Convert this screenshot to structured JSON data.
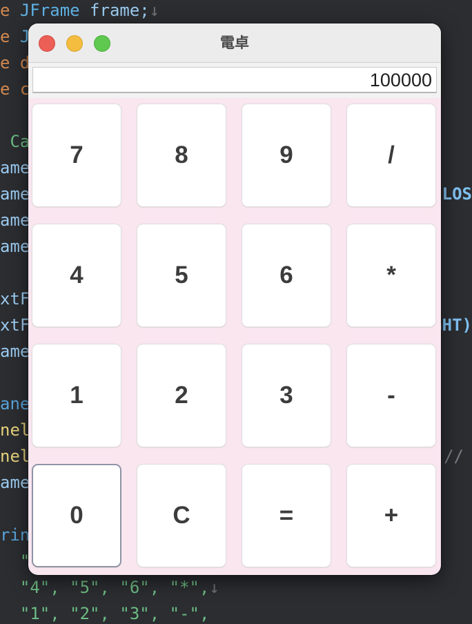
{
  "editor": {
    "lines": [
      {
        "a": "e ",
        "b": "JFrame",
        "c": " frame;",
        "d": "↓"
      },
      {
        "a": "e ",
        "b": "JT"
      },
      {
        "a": "e ",
        "b": "de"
      },
      {
        "a": "e ",
        "b": "ch"
      },
      {
        "a": " Ca"
      },
      {
        "a": "ame"
      },
      {
        "a": "ame"
      },
      {
        "a": "ame"
      },
      {
        "a": "ame"
      },
      {
        "a": "xtF:"
      },
      {
        "a": "xtF:"
      },
      {
        "a": "ame"
      },
      {
        "a": "ane"
      },
      {
        "a": "nel"
      },
      {
        "a": "nel"
      },
      {
        "a": "ame"
      },
      {
        "a": "ring"
      },
      {
        "a": "  \"",
        "b": "\""
      },
      {
        "a": "  \"4\", \"5\", \"6\", \"*\",",
        "b": "↓"
      },
      {
        "a": "  \"1\", \"2\", \"3\", \"-\","
      }
    ],
    "right_fragments": {
      "close": "CLOS",
      "right": "GHT)",
      "comment": "//"
    }
  },
  "window": {
    "title": "電卓",
    "display_value": "100000",
    "keys": [
      {
        "label": "7"
      },
      {
        "label": "8"
      },
      {
        "label": "9"
      },
      {
        "label": "/"
      },
      {
        "label": "4"
      },
      {
        "label": "5"
      },
      {
        "label": "6"
      },
      {
        "label": "*"
      },
      {
        "label": "1"
      },
      {
        "label": "2"
      },
      {
        "label": "3"
      },
      {
        "label": "-"
      },
      {
        "label": "0"
      },
      {
        "label": "C"
      },
      {
        "label": "="
      },
      {
        "label": "+"
      }
    ]
  },
  "colors": {
    "window_background": "#f9e6ef",
    "titlebar": "#ececec",
    "close_button": "#ec5f57",
    "minimize_button": "#f5bd3f",
    "maximize_button": "#5fc84f",
    "editor_background": "#2b2d31"
  }
}
